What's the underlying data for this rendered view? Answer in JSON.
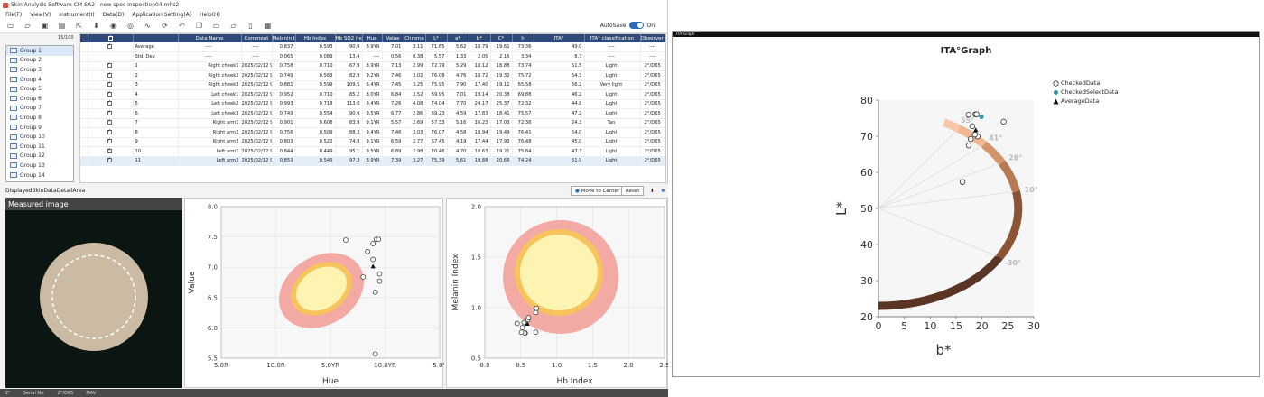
{
  "window": {
    "title": "Skin Analysis Software CM-SA2 - new spec inspection04.mhs2",
    "menu": [
      "File(F)",
      "View(V)",
      "Instrument(I)",
      "Data(D)",
      "Application Setting(A)",
      "Help(H)"
    ],
    "autosave_label": "AutoSave",
    "autosave_state": "On",
    "counter": "15/100"
  },
  "groups": [
    "Group 1",
    "Group 2",
    "Group 3",
    "Group 4",
    "Group 5",
    "Group 6",
    "Group 7",
    "Group 8",
    "Group 9",
    "Group 10",
    "Group 11",
    "Group 12",
    "Group 13",
    "Group 14"
  ],
  "table": {
    "columns": [
      "Data Name",
      "Comment",
      "Melanin Index",
      "Hb Index",
      "Hb SO2 Index(%)",
      "Hue",
      "Value",
      "Chroma",
      "L*",
      "a*",
      "b*",
      "C*",
      "h",
      "ITA°",
      "ITA° classification",
      "Observer / Illuminant"
    ],
    "summary": [
      {
        "label": "Average",
        "values": [
          "----",
          "----",
          "0.837",
          "0.593",
          "90.9",
          "8.9YR",
          "7.01",
          "3.11",
          "71.65",
          "5.62",
          "18.79",
          "19.61",
          "73.36",
          "49.0",
          "----",
          "----"
        ]
      },
      {
        "label": "Std. Dev.",
        "values": [
          "----",
          "----",
          "0.065",
          "0.089",
          "13.4",
          "----",
          "0.56",
          "0.38",
          "5.57",
          "1.33",
          "2.05",
          "2.16",
          "3.34",
          "8.7",
          "----",
          "----"
        ]
      }
    ],
    "rows": [
      {
        "no": "1",
        "values": [
          "Right cheek1",
          "2025/02/12 9:57:15",
          "0.758",
          "0.710",
          "67.9",
          "8.9YR",
          "7.13",
          "2.99",
          "72.79",
          "5.29",
          "18.12",
          "18.88",
          "73.74",
          "51.5",
          "Light",
          "2°/D65"
        ]
      },
      {
        "no": "2",
        "values": [
          "Right cheek2",
          "2025/02/12 9:57:23",
          "0.749",
          "0.563",
          "82.9",
          "9.2YR",
          "7.46",
          "3.02",
          "76.08",
          "4.76",
          "18.72",
          "19.32",
          "75.72",
          "54.3",
          "Light",
          "2°/D65"
        ]
      },
      {
        "no": "3",
        "values": [
          "Right cheek3",
          "2025/02/12 9:57:32",
          "0.881",
          "0.599",
          "109.5",
          "6.4YR",
          "7.45",
          "3.25",
          "75.95",
          "7.90",
          "17.40",
          "19.11",
          "65.58",
          "56.2",
          "Very light",
          "2°/D65"
        ]
      },
      {
        "no": "4",
        "values": [
          "Left cheek1",
          "2025/02/12 9:57:36",
          "0.952",
          "0.710",
          "85.2",
          "8.0YR",
          "6.84",
          "3.52",
          "69.95",
          "7.01",
          "19.14",
          "20.38",
          "69.88",
          "46.2",
          "Light",
          "2°/D65"
        ]
      },
      {
        "no": "5",
        "values": [
          "Left cheek2",
          "2025/02/12 9:57:44",
          "0.993",
          "0.718",
          "113.0",
          "8.4YR",
          "7.26",
          "4.08",
          "74.04",
          "7.70",
          "24.17",
          "25.37",
          "72.32",
          "44.8",
          "Light",
          "2°/D65"
        ]
      },
      {
        "no": "6",
        "values": [
          "Left cheek3",
          "2025/02/12 9:57:45",
          "0.749",
          "0.554",
          "90.9",
          "9.5YR",
          "6.77",
          "2.86",
          "69.23",
          "4.59",
          "17.83",
          "18.41",
          "75.57",
          "47.2",
          "Light",
          "2°/D65"
        ]
      },
      {
        "no": "7",
        "values": [
          "Right arm1",
          "2025/02/12 9:57:52",
          "0.901",
          "0.608",
          "83.9",
          "9.1YR",
          "5.57",
          "2.69",
          "57.33",
          "5.16",
          "16.23",
          "17.03",
          "72.36",
          "24.3",
          "Tan",
          "2°/D65"
        ]
      },
      {
        "no": "8",
        "values": [
          "Right arm2",
          "2025/02/12 9:57:57",
          "0.756",
          "0.509",
          "88.3",
          "9.4YR",
          "7.46",
          "3.03",
          "76.07",
          "4.58",
          "18.94",
          "19.49",
          "76.41",
          "54.0",
          "Light",
          "2°/D65"
        ]
      },
      {
        "no": "9",
        "values": [
          "Right arm3",
          "2025/02/12 9:58:01",
          "0.803",
          "0.522",
          "74.9",
          "9.1YR",
          "6.59",
          "2.77",
          "67.45",
          "4.19",
          "17.44",
          "17.93",
          "76.48",
          "45.0",
          "Light",
          "2°/D65"
        ]
      },
      {
        "no": "10",
        "values": [
          "Left arm1",
          "2025/02/12 9:58:06",
          "0.844",
          "0.449",
          "95.1",
          "9.5YR",
          "6.89",
          "2.98",
          "70.46",
          "4.70",
          "18.63",
          "19.21",
          "75.84",
          "47.7",
          "Light",
          "2°/D65"
        ]
      },
      {
        "no": "11",
        "values": [
          "Left arm2",
          "2025/02/12 9:58:26",
          "0.853",
          "0.545",
          "97.3",
          "8.9YR",
          "7.39",
          "3.27",
          "75.39",
          "5.61",
          "19.88",
          "20.66",
          "74.24",
          "51.9",
          "Light",
          "2°/D65"
        ]
      }
    ]
  },
  "detail": {
    "label": "DisplayedSkinDataDetailArea",
    "move_button": "Move to Center",
    "reset_button": "Reset",
    "measured_title": "Measured image"
  },
  "chart_data": [
    {
      "type": "scatter",
      "xlabel": "Hue",
      "ylabel": "Value",
      "x_ticks": [
        "5.0R",
        "10.0R",
        "5.0YR",
        "10.0YR",
        "5.0Y"
      ],
      "y_ticks": [
        "5.5",
        "6.0",
        "6.5",
        "7.0",
        "7.5",
        "8.0"
      ],
      "ylim": [
        5.5,
        8.0
      ],
      "points": [
        {
          "x": 8.9,
          "y": 7.13
        },
        {
          "x": 9.2,
          "y": 7.46
        },
        {
          "x": 6.4,
          "y": 7.45
        },
        {
          "x": 8.0,
          "y": 6.84
        },
        {
          "x": 8.4,
          "y": 7.26
        },
        {
          "x": 9.5,
          "y": 6.77
        },
        {
          "x": 9.1,
          "y": 5.57
        },
        {
          "x": 9.4,
          "y": 7.46
        },
        {
          "x": 9.1,
          "y": 6.59
        },
        {
          "x": 9.5,
          "y": 6.89
        },
        {
          "x": 8.9,
          "y": 7.39
        }
      ],
      "average": {
        "x": 8.9,
        "y": 7.01
      }
    },
    {
      "type": "scatter",
      "xlabel": "Hb Index",
      "ylabel": "Melanin Index",
      "x_ticks": [
        "0.0",
        "0.5",
        "1.0",
        "1.5",
        "2.0",
        "2.5"
      ],
      "y_ticks": [
        "0.5",
        "1.0",
        "1.5",
        "2.0"
      ],
      "xlim": [
        0,
        2.5
      ],
      "ylim": [
        0.5,
        2.0
      ],
      "points": [
        {
          "x": 0.71,
          "y": 0.758
        },
        {
          "x": 0.563,
          "y": 0.749
        },
        {
          "x": 0.599,
          "y": 0.881
        },
        {
          "x": 0.71,
          "y": 0.952
        },
        {
          "x": 0.718,
          "y": 0.993
        },
        {
          "x": 0.554,
          "y": 0.749
        },
        {
          "x": 0.608,
          "y": 0.901
        },
        {
          "x": 0.509,
          "y": 0.756
        },
        {
          "x": 0.522,
          "y": 0.803
        },
        {
          "x": 0.449,
          "y": 0.844
        },
        {
          "x": 0.545,
          "y": 0.853
        }
      ],
      "average": {
        "x": 0.593,
        "y": 0.837
      }
    },
    {
      "type": "scatter",
      "title": "ITA°Graph",
      "xlabel": "b*",
      "ylabel": "L*",
      "xlim": [
        0,
        30
      ],
      "ylim": [
        20,
        80
      ],
      "x_ticks": [
        "0",
        "5",
        "10",
        "15",
        "20",
        "25",
        "30"
      ],
      "y_ticks": [
        "20",
        "30",
        "40",
        "50",
        "60",
        "70",
        "80"
      ],
      "ita_lines": [
        "55°",
        "41°",
        "28°",
        "10°",
        "-30°"
      ],
      "legend": [
        "CheckedData",
        "CheckedSelectData",
        "AverageData"
      ],
      "points": [
        {
          "x": 18.12,
          "y": 72.79
        },
        {
          "x": 18.72,
          "y": 76.08
        },
        {
          "x": 17.4,
          "y": 75.95
        },
        {
          "x": 19.14,
          "y": 69.95
        },
        {
          "x": 24.17,
          "y": 74.04
        },
        {
          "x": 17.83,
          "y": 69.23
        },
        {
          "x": 16.23,
          "y": 57.33
        },
        {
          "x": 18.94,
          "y": 76.07
        },
        {
          "x": 17.44,
          "y": 67.45
        },
        {
          "x": 18.63,
          "y": 70.46
        }
      ],
      "selected": {
        "x": 19.88,
        "y": 75.39
      },
      "average": {
        "x": 18.79,
        "y": 71.65
      }
    }
  ],
  "ita_window_title": "ITA°Graph",
  "status": [
    "2°",
    "Serial No.",
    "2°/D65",
    "MAV"
  ]
}
